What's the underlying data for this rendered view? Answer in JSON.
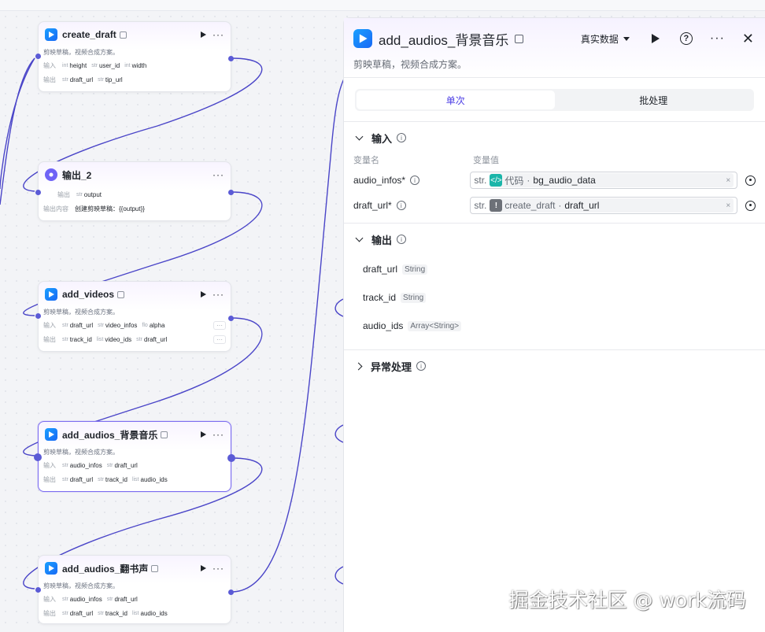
{
  "nodes": [
    {
      "title": "create_draft",
      "desc": "剪映草稿，视频合成方案。",
      "in_label": "输入",
      "out_label": "输出",
      "inputs": [
        {
          "type": "int",
          "name": "height"
        },
        {
          "type": "str",
          "name": "user_id"
        },
        {
          "type": "int",
          "name": "width"
        }
      ],
      "outputs": [
        {
          "type": "str",
          "name": "draft_url"
        },
        {
          "type": "str",
          "name": "tip_url"
        }
      ]
    },
    {
      "title": "输出_2",
      "out_label": "输出",
      "output": {
        "type": "str",
        "name": "output"
      },
      "content_label": "输出内容",
      "content": "创建剪映草稿：{{output}}"
    },
    {
      "title": "add_videos",
      "desc": "剪映草稿，视频合成方案。",
      "in_label": "输入",
      "out_label": "输出",
      "inputs": [
        {
          "type": "str",
          "name": "draft_url"
        },
        {
          "type": "str",
          "name": "video_infos"
        },
        {
          "type": "flo",
          "name": "alpha"
        }
      ],
      "outputs": [
        {
          "type": "str",
          "name": "track_id"
        },
        {
          "type": "list",
          "name": "video_ids"
        },
        {
          "type": "str",
          "name": "draft_url"
        }
      ],
      "more": "···"
    },
    {
      "title": "add_audios_背景音乐",
      "desc": "剪映草稿，视频合成方案。",
      "in_label": "输入",
      "out_label": "输出",
      "inputs": [
        {
          "type": "str",
          "name": "audio_infos"
        },
        {
          "type": "str",
          "name": "draft_url"
        }
      ],
      "outputs": [
        {
          "type": "str",
          "name": "draft_url"
        },
        {
          "type": "str",
          "name": "track_id"
        },
        {
          "type": "list",
          "name": "audio_ids"
        }
      ]
    },
    {
      "title": "add_audios_翻书声",
      "desc": "剪映草稿，视频合成方案。",
      "in_label": "输入",
      "out_label": "输出",
      "inputs": [
        {
          "type": "str",
          "name": "audio_infos"
        },
        {
          "type": "str",
          "name": "draft_url"
        }
      ],
      "outputs": [
        {
          "type": "str",
          "name": "draft_url"
        },
        {
          "type": "str",
          "name": "track_id"
        },
        {
          "type": "list",
          "name": "audio_ids"
        }
      ]
    }
  ],
  "node_more": "···",
  "panel": {
    "title": "add_audios_背景音乐",
    "desc": "剪映草稿，视频合成方案。",
    "data_select": "真实数据",
    "more": "···",
    "close": "✕",
    "help": "?",
    "tabs": [
      "单次",
      "批处理"
    ],
    "input_section": {
      "title": "输入",
      "col_name": "变量名",
      "col_value": "变量值",
      "vars": [
        {
          "name": "audio_infos*",
          "type": "str.",
          "icon_glyph": "</>",
          "ref_node": "代码",
          "ref_field": "bg_audio_data"
        },
        {
          "name": "draft_url*",
          "type": "str.",
          "icon_glyph": "!",
          "ref_node": "create_draft",
          "ref_field": "draft_url"
        }
      ]
    },
    "output_section": {
      "title": "输出",
      "items": [
        {
          "name": "draft_url",
          "type": "String"
        },
        {
          "name": "track_id",
          "type": "String"
        },
        {
          "name": "audio_ids",
          "type": "Array<String>"
        }
      ]
    },
    "error_section": {
      "title": "异常处理"
    }
  },
  "info_glyph": "i",
  "clear_glyph": "×",
  "watermark": "掘金技术社区 @ work流码",
  "colors": {
    "accent": "#5b5bd6",
    "edge": "#4a45c8",
    "tab_active": "#4e40e5",
    "node_icon": "#1868f5"
  }
}
